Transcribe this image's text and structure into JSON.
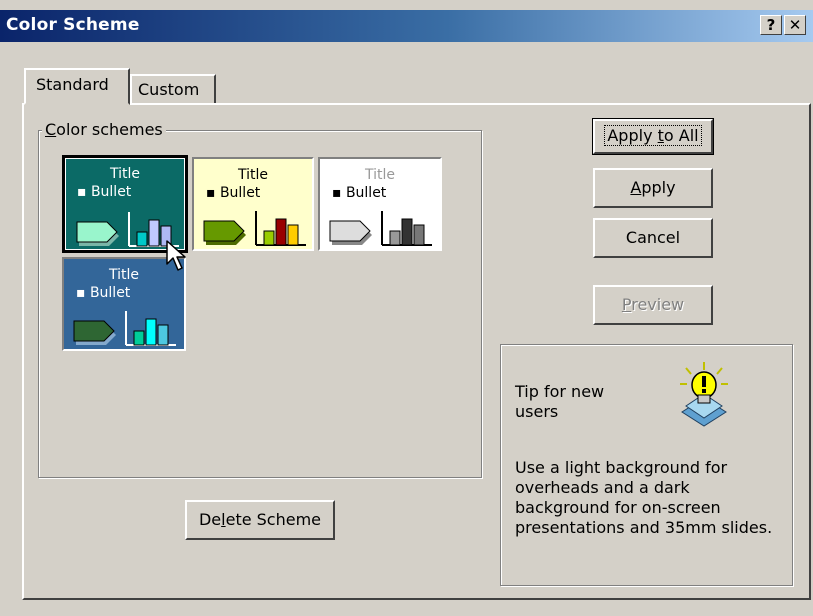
{
  "window": {
    "title": "Color Scheme",
    "help_label": "?",
    "close_label": "✕"
  },
  "tabs": [
    {
      "label": "Standard",
      "selected": true
    },
    {
      "label": "Custom",
      "selected": false
    }
  ],
  "group": {
    "label": "Color schemes",
    "accel": "C",
    "label_rest": "olor schemes"
  },
  "schemes": [
    {
      "title": "Title",
      "bullet": "▪ Bullet",
      "bg": "#0b6a66",
      "title_color": "#ffffff",
      "bullet_color": "#ffffff",
      "arrow": "#99f5cc",
      "arrow_shadow": "#7ab6a8",
      "bars": [
        "#00c8c8",
        "#c0c8ff",
        "#aeb8f4"
      ],
      "selected": true
    },
    {
      "title": "Title",
      "bullet": "▪ Bullet",
      "bg": "#ffffcc",
      "title_color": "#000000",
      "bullet_color": "#000000",
      "arrow": "#669900",
      "arrow_shadow": "#4d6b00",
      "bars": [
        "#99cc00",
        "#990000",
        "#ffcc00"
      ],
      "selected": false
    },
    {
      "title": "Title",
      "bullet": "▪ Bullet",
      "bg": "#ffffff",
      "title_color": "#999999",
      "bullet_color": "#000000",
      "arrow": "#dddddd",
      "arrow_shadow": "#888888",
      "bars": [
        "#999999",
        "#333333",
        "#777777"
      ],
      "selected": false
    },
    {
      "title": "Title",
      "bullet": "▪ Bullet",
      "bg": "#336699",
      "title_color": "#ffffff",
      "bullet_color": "#ffffff",
      "arrow": "#2e6633",
      "arrow_shadow": "#84a9cc",
      "bars": [
        "#00cc99",
        "#00ffff",
        "#4dc8e0"
      ],
      "selected": false
    }
  ],
  "buttons": {
    "apply_all": {
      "before": "Apply ",
      "accel": "t",
      "after": "o All"
    },
    "apply": {
      "before": "",
      "accel": "A",
      "after": "pply"
    },
    "cancel": {
      "label": "Cancel"
    },
    "preview": {
      "before": "",
      "accel": "P",
      "after": "review",
      "disabled": true
    },
    "delete": {
      "before": "De",
      "accel": "l",
      "after": "ete Scheme"
    }
  },
  "tip": {
    "title": "Tip for new users",
    "text": "Use a light background for overheads and a dark background for on-screen presentations and 35mm slides.",
    "icon": "lightbulb-icon"
  },
  "colors": {
    "titlebar_start": "#0a246a",
    "titlebar_end": "#a6caf0",
    "dialog_bg": "#d4d0c8"
  }
}
